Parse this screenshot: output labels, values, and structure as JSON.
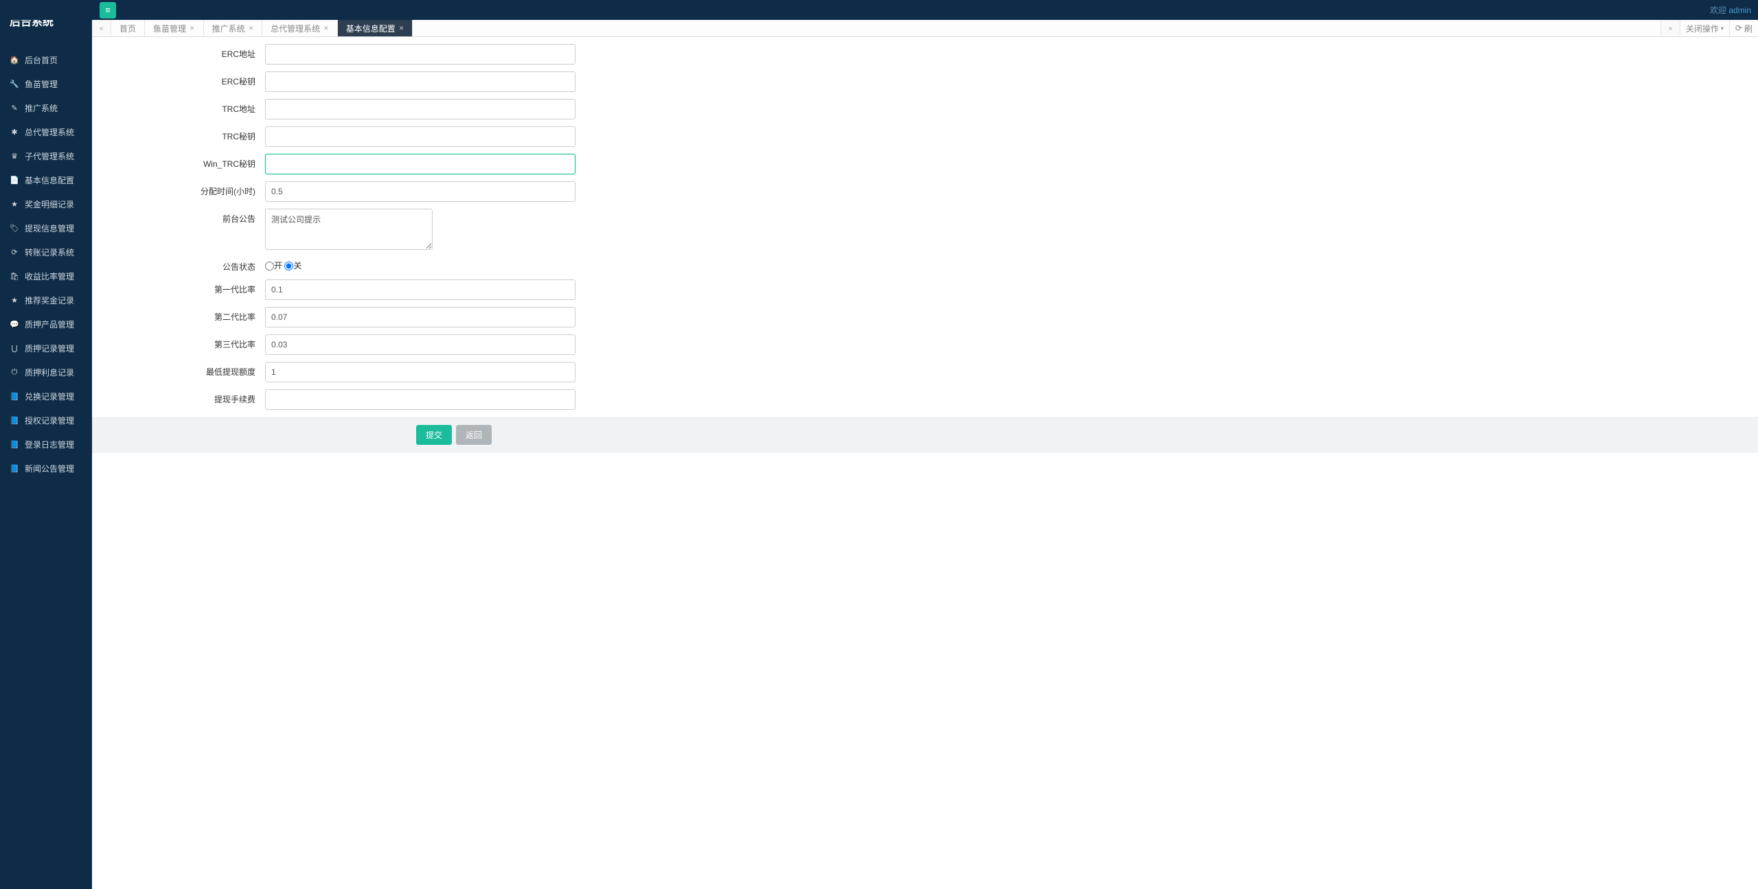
{
  "header": {
    "welcome_prefix": "欢迎 ",
    "welcome_user": "admin"
  },
  "sidebar": {
    "title": "后台系统",
    "items": [
      {
        "icon": "🏠",
        "label": "后台首页"
      },
      {
        "icon": "🔧",
        "label": "鱼苗管理"
      },
      {
        "icon": "✎",
        "label": "推广系统"
      },
      {
        "icon": "✱",
        "label": "总代管理系统"
      },
      {
        "icon": "♛",
        "label": "子代管理系统"
      },
      {
        "icon": "📄",
        "label": "基本信息配置"
      },
      {
        "icon": "★",
        "label": "奖金明细记录"
      },
      {
        "icon": "🏷",
        "label": "提现信息管理"
      },
      {
        "icon": "⟳",
        "label": "转账记录系统"
      },
      {
        "icon": "🛍",
        "label": "收益比率管理"
      },
      {
        "icon": "★",
        "label": "推荐奖金记录"
      },
      {
        "icon": "💬",
        "label": "质押产品管理"
      },
      {
        "icon": "⋃",
        "label": "质押记录管理"
      },
      {
        "icon": "⏻",
        "label": "质押利息记录"
      },
      {
        "icon": "📘",
        "label": "兑换记录管理"
      },
      {
        "icon": "📘",
        "label": "授权记录管理"
      },
      {
        "icon": "📘",
        "label": "登录日志管理"
      },
      {
        "icon": "📘",
        "label": "新闻公告管理"
      }
    ]
  },
  "tabs": {
    "items": [
      {
        "label": "首页",
        "closable": false,
        "active": false
      },
      {
        "label": "鱼苗管理",
        "closable": true,
        "active": false
      },
      {
        "label": "推广系统",
        "closable": true,
        "active": false
      },
      {
        "label": "总代管理系统",
        "closable": true,
        "active": false
      },
      {
        "label": "基本信息配置",
        "closable": true,
        "active": true
      }
    ],
    "close_ops": "关闭操作",
    "refresh": "刷"
  },
  "form": {
    "erc_address": {
      "label": "ERC地址",
      "value": ""
    },
    "erc_secret": {
      "label": "ERC秘钥",
      "value": ""
    },
    "trc_address": {
      "label": "TRC地址",
      "value": ""
    },
    "trc_secret": {
      "label": "TRC秘钥",
      "value": ""
    },
    "win_trc_secret": {
      "label": "Win_TRC秘钥",
      "value": ""
    },
    "alloc_time": {
      "label": "分配时间(小时)",
      "value": "0.5"
    },
    "front_notice": {
      "label": "前台公告",
      "value": "测试公司提示"
    },
    "notice_status": {
      "label": "公告状态",
      "on": "开",
      "off": "关"
    },
    "gen1_rate": {
      "label": "第一代比率",
      "value": "0.1"
    },
    "gen2_rate": {
      "label": "第二代比率",
      "value": "0.07"
    },
    "gen3_rate": {
      "label": "第三代比率",
      "value": "0.03"
    },
    "min_withdraw": {
      "label": "最低提现额度",
      "value": "1"
    },
    "withdraw_fee": {
      "label": "提现手续费",
      "value": ""
    },
    "submit": "提交",
    "back": "返回"
  }
}
